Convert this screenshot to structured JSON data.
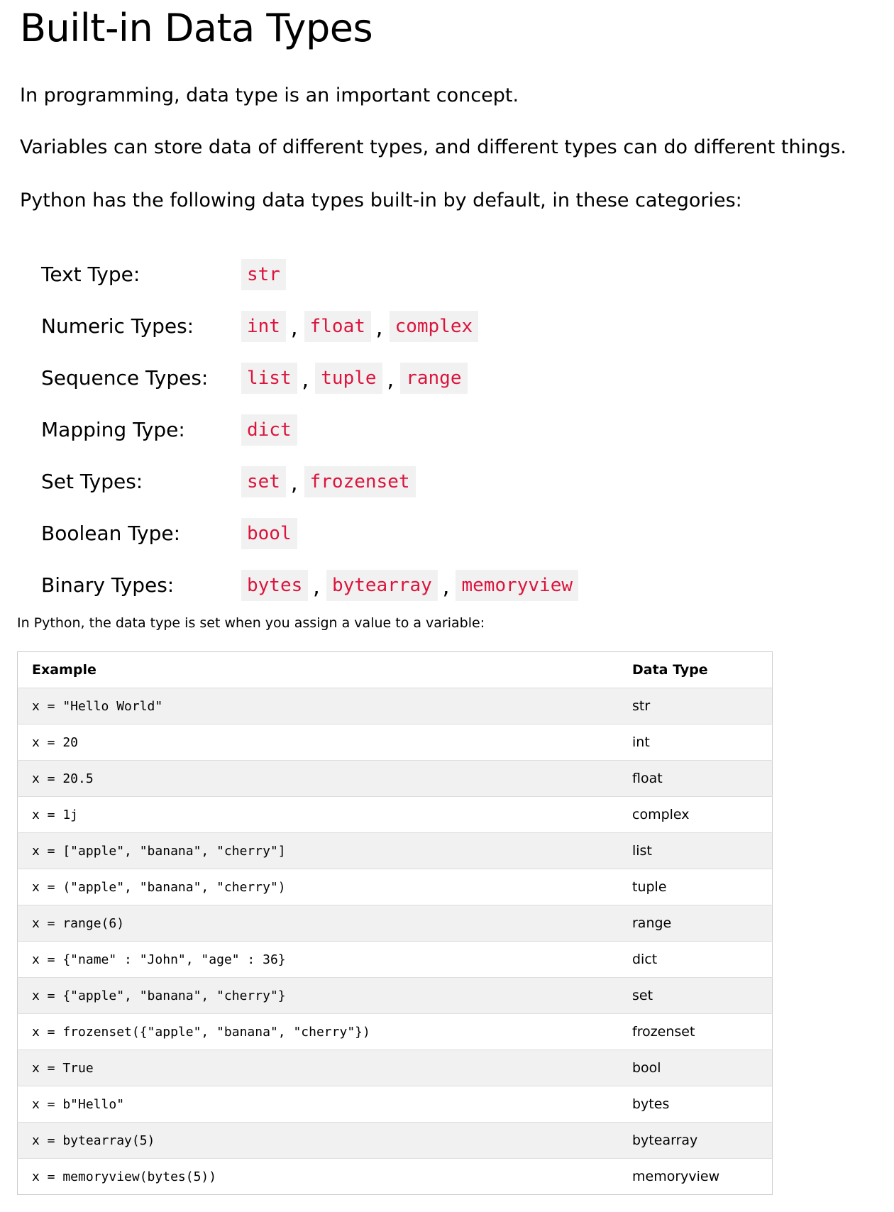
{
  "title": "Built-in Data Types",
  "paragraphs": [
    "In programming, data type is an important concept.",
    "Variables can store data of different types, and different types can do different things.",
    "Python has the following data types built-in by default, in these categories:"
  ],
  "categories": [
    {
      "label": "Text Type:",
      "types": [
        "str"
      ]
    },
    {
      "label": "Numeric Types:",
      "types": [
        "int",
        "float",
        "complex"
      ]
    },
    {
      "label": "Sequence Types:",
      "types": [
        "list",
        "tuple",
        "range"
      ]
    },
    {
      "label": "Mapping Type:",
      "types": [
        "dict"
      ]
    },
    {
      "label": "Set Types:",
      "types": [
        "set",
        "frozenset"
      ]
    },
    {
      "label": "Boolean Type:",
      "types": [
        "bool"
      ]
    },
    {
      "label": "Binary Types:",
      "types": [
        "bytes",
        "bytearray",
        "memoryview"
      ]
    }
  ],
  "intro2": "In Python, the data type is set when you assign a value to a variable:",
  "table": {
    "headers": [
      "Example",
      "Data Type"
    ],
    "rows": [
      {
        "example": "x = \"Hello World\"",
        "type": "str"
      },
      {
        "example": "x = 20",
        "type": "int"
      },
      {
        "example": "x = 20.5",
        "type": "float"
      },
      {
        "example": "x = 1j",
        "type": "complex"
      },
      {
        "example": "x = [\"apple\", \"banana\", \"cherry\"]",
        "type": "list"
      },
      {
        "example": "x = (\"apple\", \"banana\", \"cherry\")",
        "type": "tuple"
      },
      {
        "example": "x = range(6)",
        "type": "range"
      },
      {
        "example": "x = {\"name\" : \"John\", \"age\" : 36}",
        "type": "dict"
      },
      {
        "example": "x = {\"apple\", \"banana\", \"cherry\"}",
        "type": "set"
      },
      {
        "example": "x = frozenset({\"apple\", \"banana\", \"cherry\"})",
        "type": "frozenset"
      },
      {
        "example": "x = True",
        "type": "bool"
      },
      {
        "example": "x = b\"Hello\"",
        "type": "bytes"
      },
      {
        "example": "x = bytearray(5)",
        "type": "bytearray"
      },
      {
        "example": "x = memoryview(bytes(5))",
        "type": "memoryview"
      }
    ]
  },
  "colors": {
    "code_text": "#dc143c",
    "code_bg": "#f1f1f1",
    "row_alt_bg": "#f1f1f1",
    "border": "#cccccc"
  }
}
